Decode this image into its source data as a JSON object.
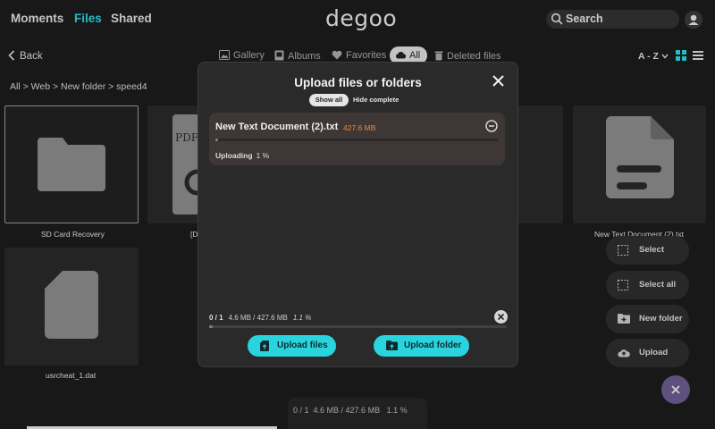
{
  "nav": {
    "moments": "Moments",
    "files": "Files",
    "shared": "Shared"
  },
  "brand": {
    "logo": "degoo",
    "accent": "#2bd6e0"
  },
  "search": {
    "placeholder": "Search"
  },
  "toolbar": {
    "back": "Back",
    "tabs": [
      "Gallery",
      "Albums",
      "Favorites",
      "All",
      "Deleted files"
    ],
    "sort": "A - Z"
  },
  "breadcrumb": "All > Web > New folder > speed4",
  "files": [
    {
      "label": "SD Card Recovery",
      "type": "folder"
    },
    {
      "label": "[D",
      "type": "pdf"
    },
    {
      "label": "New Text Document (2).txt",
      "type": "document"
    },
    {
      "label": "usrcheat_1.dat",
      "type": "file"
    }
  ],
  "actions": [
    "Select",
    "Select all",
    "New folder",
    "Upload"
  ],
  "modal": {
    "title": "Upload files or folders",
    "filter_show_all": "Show all",
    "filter_hide_complete": "Hide complete",
    "item": {
      "name": "New Text Document (2).txt",
      "size": "427.6 MB",
      "status": "Uploading",
      "percent_label": "1 %",
      "progress": 0.01
    },
    "total": {
      "count": "0 / 1",
      "transferred": "4.6 MB / 427.6 MB",
      "percent_label": "1.1 %",
      "progress": 0.011
    },
    "upload_files": "Upload files",
    "upload_folder": "Upload folder"
  },
  "bottom_status": {
    "count": "0 / 1",
    "transferred": "4.6 MB / 427.6 MB",
    "percent_label": "1.1 %"
  }
}
